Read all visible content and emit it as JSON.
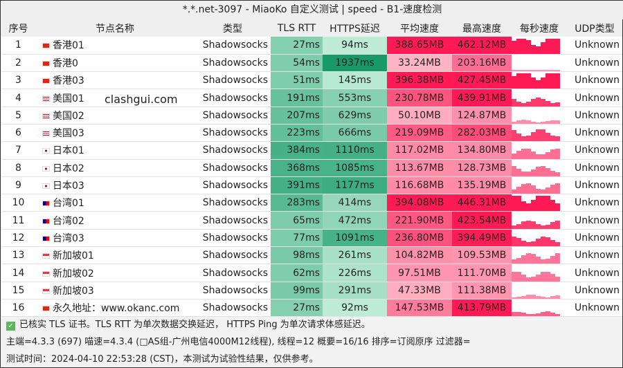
{
  "title": "*.*.net-3097 - MiaoKo 自定义测试 | speed - B1-速度检测",
  "headers": [
    "序号",
    "节点名称",
    "类型",
    "TLS RTT",
    "HTTPS延迟",
    "平均速度",
    "最高速度",
    "每秒速度",
    "UDP类型"
  ],
  "watermark": "clashgui.com",
  "colors": {
    "green_light": "#c8f0dc",
    "green_dark": "#179a68",
    "red_light": "#ffc4d0",
    "red_dark": "#ff1a55"
  },
  "rows": [
    {
      "n": "1",
      "flag": "hk",
      "name": "香港01",
      "type": "Shadowsocks",
      "tls": "27ms",
      "https": "94ms",
      "avg": "388.65MB",
      "max": "462.12MB",
      "udp": "Unknown"
    },
    {
      "n": "2",
      "flag": "hk",
      "name": "香港0",
      "type": "Shadowsocks",
      "tls": "54ms",
      "https": "1937ms",
      "avg": "33.24MB",
      "max": "203.16MB",
      "udp": "Unknown"
    },
    {
      "n": "3",
      "flag": "hk",
      "name": "香港03",
      "type": "Shadowsocks",
      "tls": "51ms",
      "https": "145ms",
      "avg": "396.38MB",
      "max": "427.45MB",
      "udp": "Unknown"
    },
    {
      "n": "4",
      "flag": "us",
      "name": "美国01",
      "type": "Shadowsocks",
      "tls": "191ms",
      "https": "553ms",
      "avg": "230.78MB",
      "max": "439.91MB",
      "udp": "Unknown"
    },
    {
      "n": "5",
      "flag": "us",
      "name": "美国02",
      "type": "Shadowsocks",
      "tls": "207ms",
      "https": "629ms",
      "avg": "50.10MB",
      "max": "124.87MB",
      "udp": "Unknown"
    },
    {
      "n": "6",
      "flag": "us",
      "name": "美国03",
      "type": "Shadowsocks",
      "tls": "223ms",
      "https": "666ms",
      "avg": "219.09MB",
      "max": "282.03MB",
      "udp": "Unknown"
    },
    {
      "n": "7",
      "flag": "jp",
      "name": "日本01",
      "type": "Shadowsocks",
      "tls": "384ms",
      "https": "1110ms",
      "avg": "117.02MB",
      "max": "134.80MB",
      "udp": "Unknown"
    },
    {
      "n": "8",
      "flag": "jp",
      "name": "日本02",
      "type": "Shadowsocks",
      "tls": "368ms",
      "https": "1085ms",
      "avg": "113.67MB",
      "max": "128.73MB",
      "udp": "Unknown"
    },
    {
      "n": "9",
      "flag": "jp",
      "name": "日本03",
      "type": "Shadowsocks",
      "tls": "391ms",
      "https": "1177ms",
      "avg": "116.68MB",
      "max": "135.19MB",
      "udp": "Unknown"
    },
    {
      "n": "10",
      "flag": "tw",
      "name": "台湾01",
      "type": "Shadowsocks",
      "tls": "283ms",
      "https": "414ms",
      "avg": "394.08MB",
      "max": "446.31MB",
      "udp": "Unknown"
    },
    {
      "n": "11",
      "flag": "tw",
      "name": "台湾02",
      "type": "Shadowsocks",
      "tls": "65ms",
      "https": "472ms",
      "avg": "221.90MB",
      "max": "423.54MB",
      "udp": "Unknown"
    },
    {
      "n": "12",
      "flag": "tw",
      "name": "台湾03",
      "type": "Shadowsocks",
      "tls": "77ms",
      "https": "1091ms",
      "avg": "236.80MB",
      "max": "394.49MB",
      "udp": "Unknown"
    },
    {
      "n": "13",
      "flag": "sg",
      "name": "新加坡01",
      "type": "Shadowsocks",
      "tls": "98ms",
      "https": "261ms",
      "avg": "104.82MB",
      "max": "109.53MB",
      "udp": "Unknown"
    },
    {
      "n": "14",
      "flag": "sg",
      "name": "新加坡02",
      "type": "Shadowsocks",
      "tls": "62ms",
      "https": "226ms",
      "avg": "97.51MB",
      "max": "111.70MB",
      "udp": "Unknown"
    },
    {
      "n": "15",
      "flag": "sg",
      "name": "新加坡03",
      "type": "Shadowsocks",
      "tls": "99ms",
      "https": "291ms",
      "avg": "47.33MB",
      "max": "111.38MB",
      "udp": "Unknown"
    },
    {
      "n": "16",
      "flag": "cn",
      "name": "永久地址：www.okanc.com",
      "type": "Shadowsocks",
      "tls": "27ms",
      "https": "92ms",
      "avg": "147.53MB",
      "max": "413.79MB",
      "udp": "Unknown"
    }
  ],
  "footer": {
    "line1": "已核实 TLS 证书。TLS RTT 为单次数据交换延迟， HTTPS Ping 为单次请求体感延迟。",
    "line2": "主端=4.3.3 (697) 喵速=4.3.4 (□AS组-广州电信4000M12线程), 线程=12 概要=16/16 排序=订阅原序 过滤器=",
    "line3": "测试时间：2024-04-10 22:53:28 (CST)，本测试为试验性结果，仅供参考。"
  }
}
